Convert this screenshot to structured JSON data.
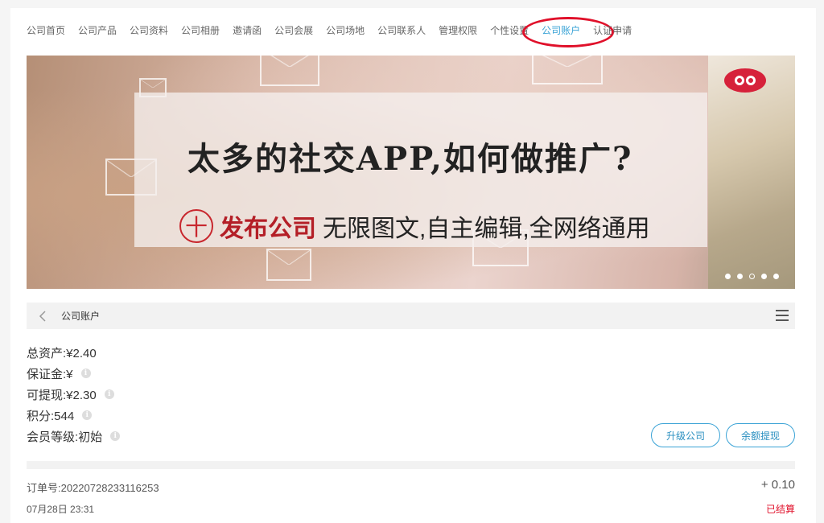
{
  "topnav": {
    "items": [
      {
        "label": "公司首页"
      },
      {
        "label": "公司产品"
      },
      {
        "label": "公司资料"
      },
      {
        "label": "公司相册"
      },
      {
        "label": "邀请函"
      },
      {
        "label": "公司会展"
      },
      {
        "label": "公司场地"
      },
      {
        "label": "公司联系人"
      },
      {
        "label": "管理权限"
      },
      {
        "label": "个性设置"
      },
      {
        "label": "公司账户"
      },
      {
        "label": "认证申请"
      }
    ],
    "active_index": 10,
    "active_color": "#3aa3d6",
    "highlight_color": "#e0102a"
  },
  "banner": {
    "headline": "太多的社交APP,如何做推广?",
    "plus_symbol": "十",
    "sub_strong": "发布公司",
    "sub_normal": "无限图文,自主编辑,全网络通用",
    "logo_icon": "100-logo-icon",
    "slides_count": 5,
    "active_slide": 2
  },
  "titlebar": {
    "back_icon": "chevron-left-icon",
    "title": "公司账户",
    "menu_icon": "hamburger-menu-icon"
  },
  "account": {
    "total_assets": "总资产:¥2.40",
    "deposit": "保证金:¥",
    "withdrawable": "可提现:¥2.30",
    "points": "积分:544",
    "member_level": "会员等级:初始"
  },
  "actions": {
    "upgrade_label": "升级公司",
    "withdraw_label": "余额提现"
  },
  "order": {
    "number_text": "订单号:20220728233116253",
    "amount": "+ 0.10",
    "time": "07月28日 23:31",
    "status": "已结算",
    "status_color": "#e0102a"
  }
}
